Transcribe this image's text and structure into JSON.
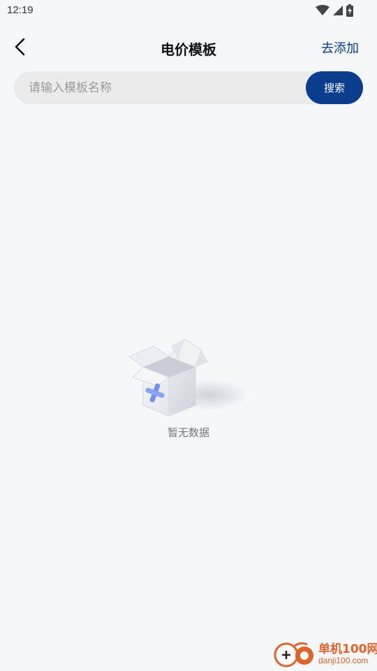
{
  "status_bar": {
    "time": "12:19",
    "icons": [
      "wifi-icon",
      "cell-signal-icon",
      "battery-charging-icon"
    ]
  },
  "nav": {
    "back_icon": "chevron-left-icon",
    "title": "电价模板",
    "action_label": "去添加"
  },
  "search": {
    "placeholder": "请输入模板名称",
    "value": "",
    "button_label": "搜索"
  },
  "empty_state": {
    "illustration": "empty-box-icon",
    "text": "暂无数据"
  },
  "watermark": {
    "title": "单机100网",
    "url": "danji100.com"
  },
  "colors": {
    "accent": "#0b3d8f",
    "background": "#f6f7f9",
    "search_bg": "#ebebeb",
    "watermark": "#e2622a"
  }
}
